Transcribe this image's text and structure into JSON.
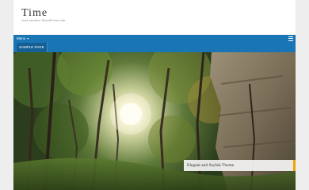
{
  "site": {
    "title": "Time",
    "tagline": "Just another WordPress site"
  },
  "nav": {
    "menu_label": "Menu",
    "caret": "▾",
    "items": [
      {
        "label": "SAMPLE PAGE"
      }
    ]
  },
  "slider": {
    "caption": "Elegant and Stylish Theme"
  },
  "colors": {
    "nav_bar": "#1a75b5",
    "caption_accent": "#f0a500"
  },
  "icons": {
    "hamburger": "hamburger-menu-icon"
  }
}
